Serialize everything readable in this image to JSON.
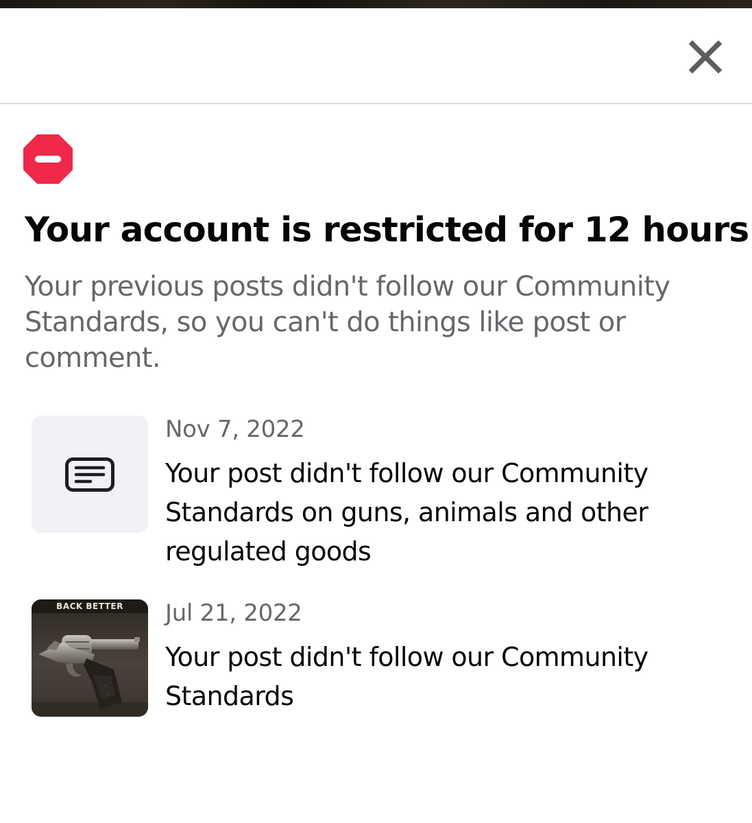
{
  "header": {
    "close_icon": "close-icon"
  },
  "notice": {
    "icon": "restricted-icon",
    "icon_color": "#f02849",
    "title": "Your account is restricted for 12 hours",
    "description": "Your previous posts didn't follow our Community Standards, so you can't do things like post or comment."
  },
  "violations": [
    {
      "date": "Nov 7, 2022",
      "message": "Your post didn't follow our Community Standards on guns, animals and other regulated goods",
      "thumbnail_icon": "post-text-icon"
    },
    {
      "date": "Jul 21, 2022",
      "message": "Your post didn't follow our Community Standards",
      "thumbnail_caption": "BACK BETTER"
    }
  ],
  "colors": {
    "primary_text": "#050505",
    "secondary_text": "#65676b",
    "divider": "#dadde1",
    "thumb_background": "#f0f2f5"
  }
}
